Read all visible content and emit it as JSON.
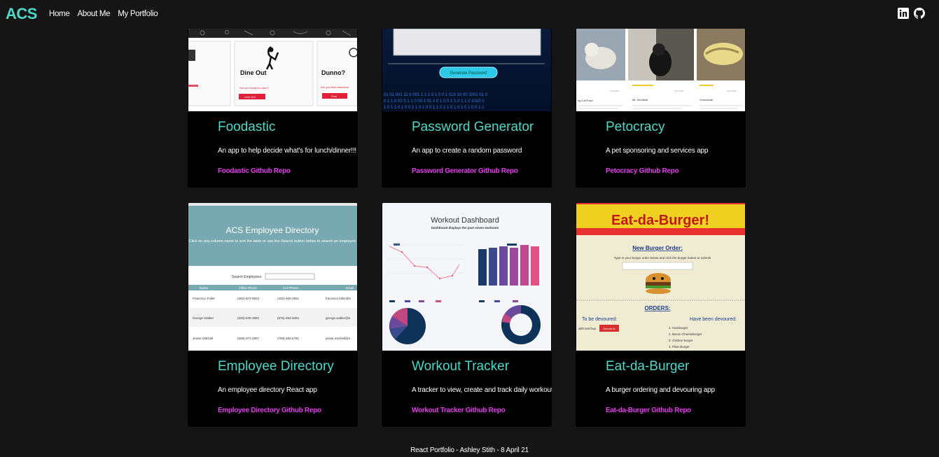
{
  "navbar": {
    "brand": "ACS",
    "links": [
      "Home",
      "About Me",
      "My Portfolio"
    ],
    "icons": [
      "linkedin-icon",
      "github-icon"
    ]
  },
  "projects": [
    {
      "title": "Foodastic",
      "description": "An app to help decide what's for lunch/dinner!!!",
      "repo_link": "Foodastic Github Repo",
      "thumb_text": [
        "Dine Out",
        "Dunno?",
        "Are you ready to roam?",
        "Are you that indecisive",
        "Let's Go!",
        "Free"
      ]
    },
    {
      "title": "Password Generator",
      "description": "An app to create a random password",
      "repo_link": "Password Generator Github Repo",
      "thumb_text": [
        "Generate Password"
      ]
    },
    {
      "title": "Petocracy",
      "description": "A pet sponsoring and services app",
      "repo_link": "Petocracy Github Repo",
      "thumb_text": [
        "Mr. Woofball",
        "Snoozarah"
      ]
    },
    {
      "title": "Employee Directory",
      "description": "An employee directory React app",
      "repo_link": "Employee Directory Github Repo",
      "thumb_text": [
        "ACS Employee Directory",
        "Click on any column name to sort the table or use the Search button below to search an employee",
        "Search Employees:",
        "Name",
        "Office Phone",
        "Cell Phone",
        "Email",
        "Francisco Fuller",
        "George Walker",
        "Jessie Mitchell"
      ]
    },
    {
      "title": "Workout Tracker",
      "description": "A tracker to view, create and track daily workouts",
      "repo_link": "Workout Tracker Github Repo",
      "thumb_text": [
        "Workout Dashboard",
        "Dashboard displays the past seven workouts"
      ]
    },
    {
      "title": "Eat-da-Burger",
      "description": "A burger ordering and devouring app",
      "repo_link": "Eat-da-Burger Github Repo",
      "thumb_text": [
        "Eat-da-Burger!",
        "New Burger Order:",
        "Type in your burger order below and click the burger button to submit!",
        "ORDERS:",
        "To be devoured:",
        "Have been devoured:",
        "with ketchup",
        "Devour it!",
        "1. Hamburger",
        "2. Bacon Cheeseburger",
        "3. chicken burger",
        "4. Plain Burger"
      ]
    }
  ],
  "footer": "React Portfolio - Ashley Stith - 8 April 21",
  "colors": {
    "background": "#151515",
    "card": "#000000",
    "accent": "#4fd8c8",
    "link": "#e040e8"
  }
}
